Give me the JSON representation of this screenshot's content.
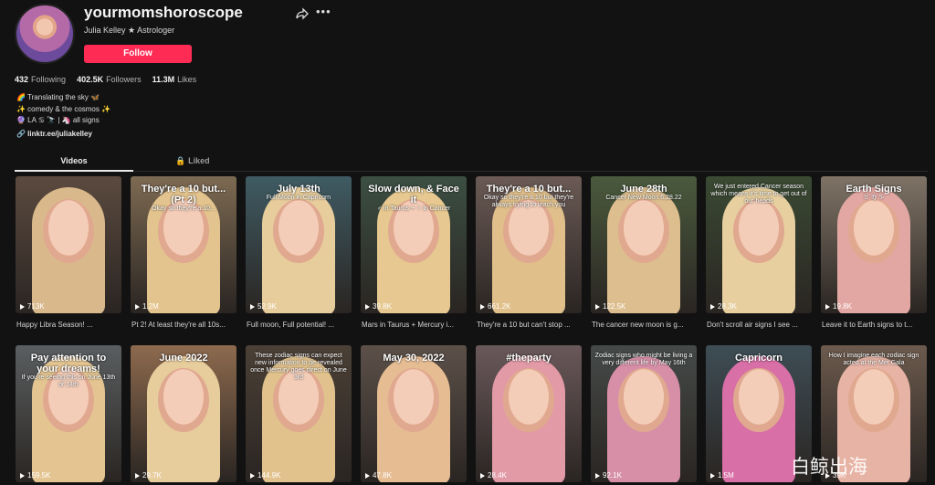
{
  "profile": {
    "username": "yourmomshoroscope",
    "subtitle": "Julia Kelley ★ Astrologer",
    "follow_label": "Follow",
    "stats": [
      {
        "value": "432",
        "label": "Following"
      },
      {
        "value": "402.5K",
        "label": "Followers"
      },
      {
        "value": "11.3M",
        "label": "Likes"
      }
    ],
    "bio": [
      "🌈 Translating the sky 🦋",
      "✨ comedy & the cosmos ✨",
      "🔮 LA ♋ 🔭 | 🦄 all signs"
    ],
    "link": "🔗 linktr.ee/juliakelley"
  },
  "tabs": {
    "videos": "Videos",
    "liked": "🔒 Liked"
  },
  "videos_row1": [
    {
      "views": "713K",
      "caption": "Happy Libra Season! ...",
      "overlay": "",
      "big": "",
      "bg": "#5b4a3f",
      "hair": "#d9b98c"
    },
    {
      "views": "1.2M",
      "caption": "Pt 2! At least they're all 10s...",
      "overlay": "Okay so they're a 10...",
      "big": "They're a 10 but... (Pt 2)",
      "bg": "#7d6a52",
      "hair": "#e4c48e"
    },
    {
      "views": "52.9K",
      "caption": "Full moon, Full potential! ...",
      "overlay": "Full Moon in Capricorn",
      "big": "July 13th",
      "bg": "#3f5b63",
      "hair": "#e8cd9c"
    },
    {
      "views": "39.8K",
      "caption": "Mars in Taurus + Mercury i...",
      "overlay": "♂ in Taurus + ☿ in Cancer",
      "big": "Slow down, & Face it",
      "bg": "#3c4f43",
      "hair": "#e6c890"
    },
    {
      "views": "661.2K",
      "caption": "They're a 10 but can't stop ...",
      "overlay": "Okay so they're a 10 but they're always trying to teach you",
      "big": "They're a 10 but...",
      "bg": "#6b5a55",
      "hair": "#e0bf8a"
    },
    {
      "views": "122.5K",
      "caption": "The cancer new moon is g...",
      "overlay": "Cancer New Moon 6.28.22",
      "big": "June 28th",
      "bg": "#4a5a3d",
      "hair": "#ddbe8e"
    },
    {
      "views": "28.3K",
      "caption": "Don't scroll air signs I see ...",
      "overlay": "We just entered Cancer season which means it's time to get out of our heads",
      "big": "",
      "bg": "#3a4a33",
      "hair": "#e7cf9f"
    },
    {
      "views": "19.8K",
      "caption": "Leave it to Earth signs to t...",
      "overlay": "♉ ♍ ♑",
      "big": "Earth Signs",
      "bg": "#7f7366",
      "hair": "#e2a7a2"
    }
  ],
  "videos_row2": [
    {
      "views": "159.5K",
      "overlay": "If you're seeing this on June 13th or 14th",
      "big": "Pay attention to your dreams!",
      "bg": "#5a5e60",
      "hair": "#e4c591"
    },
    {
      "views": "29.7K",
      "overlay": "",
      "big": "June 2022",
      "bg": "#8d6a4e",
      "hair": "#e7cc9c"
    },
    {
      "views": "144.9K",
      "overlay": "These zodiac signs can expect new information to be revealed once Mercury goes direct on June 3rd",
      "big": "",
      "bg": "#4b4036",
      "hair": "#e1c28d"
    },
    {
      "views": "47.8K",
      "overlay": "",
      "big": "May 30, 2022",
      "bg": "#5c5049",
      "hair": "#e6bc92"
    },
    {
      "views": "28.4K",
      "overlay": "",
      "big": "#theparty",
      "bg": "#6a585a",
      "hair": "#e29aa6"
    },
    {
      "views": "92.1K",
      "overlay": "Zodiac signs who might be living a very different life by May 16th",
      "big": "",
      "bg": "#454a48",
      "hair": "#d78fa8"
    },
    {
      "views": "1.5M",
      "overlay": "",
      "big": "Capricorn",
      "bg": "#3e4d55",
      "hair": "#d86fa6"
    },
    {
      "views": "39K",
      "overlay": "How I imagine each zodiac sign acted at the Met Gala",
      "big": "",
      "bg": "#6c5a4d",
      "hair": "#e7b3a5"
    }
  ],
  "watermark": "白鲸出海"
}
